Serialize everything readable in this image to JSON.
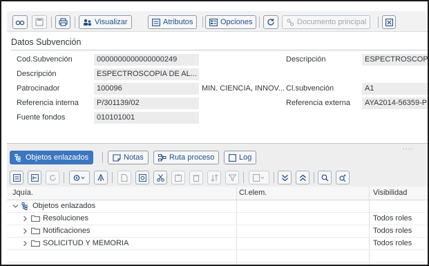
{
  "toolbar": {
    "visualizar": "Visualizar",
    "atributos": "Atributos",
    "opciones": "Opciones",
    "documento_principal": "Documento principal"
  },
  "datos": {
    "title": "Datos Subvención",
    "fields": {
      "cod_subvencion": {
        "label": "Cod.Subvención",
        "value": "0000000000000000249"
      },
      "descripcion": {
        "label": "Descripción",
        "value": "ESPECTROSCOPIA DE AL..."
      },
      "patrocinador": {
        "label": "Patrocinador",
        "value": "100096",
        "name": "MIN. CIENCIA, INNOV..."
      },
      "referencia_interna": {
        "label": "Referencia interna",
        "value": "P/301139/02"
      },
      "fuente_fondos": {
        "label": "Fuente fondos",
        "value": "010101001"
      },
      "descripcion_right": {
        "label": "Descripción",
        "value": "ESPECTROSCOPI"
      },
      "cl_subvencion": {
        "label": "Cl.subvención",
        "value": "A1"
      },
      "referencia_externa": {
        "label": "Referencia externa",
        "value": "AYA2014-56359-P"
      }
    }
  },
  "tabs": {
    "objetos": "Objetos enlazados",
    "notas": "Notas",
    "ruta": "Ruta proceso",
    "log": "Log"
  },
  "grid": {
    "columns": {
      "jquia": "Jquía.",
      "clelem": "Cl.elem.",
      "visibilidad": "Visibilidad"
    },
    "root": "Objetos enlazados",
    "rows": [
      {
        "name": "Resoluciones",
        "visibility": "Todos roles"
      },
      {
        "name": "Notificaciones",
        "visibility": "Todos roles"
      },
      {
        "name": "SOLICITUD Y MEMORIA",
        "visibility": "Todos roles"
      }
    ]
  },
  "colors": {
    "accent": "#3b76bf",
    "link": "#1d4f8c",
    "field_bg": "#ececec",
    "panel_bg": "#eeeeee"
  }
}
